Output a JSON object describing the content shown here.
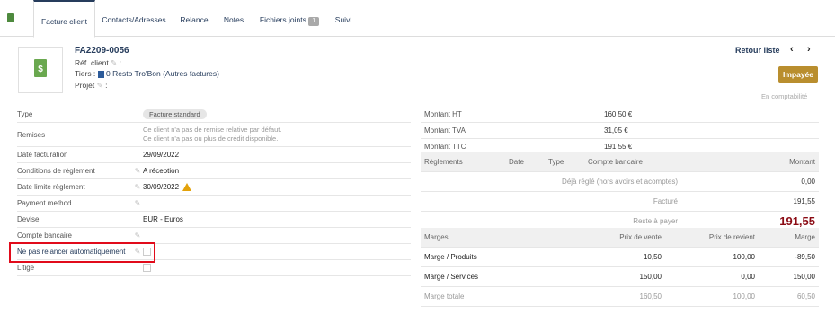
{
  "tabs": [
    {
      "label": "Facture client"
    },
    {
      "label": "Contacts/Adresses"
    },
    {
      "label": "Relance"
    },
    {
      "label": "Notes"
    },
    {
      "label": "Fichiers joints",
      "badge": "1"
    },
    {
      "label": "Suivi"
    }
  ],
  "header": {
    "ref": "FA2209-0056",
    "ref_client_label": "Réf. client",
    "tiers_label": "Tiers :",
    "tiers_value": "0 Resto Tro'Bon (Autres factures)",
    "projet_label": "Projet",
    "retour": "Retour liste",
    "status": "Impayée",
    "compta": "En comptabilité",
    "thumb_symbol": "$"
  },
  "fields": {
    "type_label": "Type",
    "type_value": "Facture standard",
    "remises_label": "Remises",
    "remises_hint1": "Ce client n'a pas de remise relative par défaut.",
    "remises_hint2": "Ce client n'a pas ou plus de crédit disponible.",
    "date_label": "Date facturation",
    "date_value": "29/09/2022",
    "cond_label": "Conditions de règlement",
    "cond_value": "A réception",
    "limite_label": "Date limite règlement",
    "limite_value": "30/09/2022",
    "payment_label": "Payment method",
    "devise_label": "Devise",
    "devise_value": "EUR - Euros",
    "compte_label": "Compte bancaire",
    "relance_label": "Ne pas relancer automatiquement",
    "litige_label": "Litige"
  },
  "amounts": {
    "ht_label": "Montant HT",
    "ht_value": "160,50 €",
    "tva_label": "Montant TVA",
    "tva_value": "31,05 €",
    "ttc_label": "Montant TTC",
    "ttc_value": "191,55 €"
  },
  "reglements": {
    "headers": [
      "Règlements",
      "Date",
      "Type",
      "Compte bancaire",
      "Montant"
    ],
    "deja_label": "Déjà réglé (hors avoirs et acomptes)",
    "deja_value": "0,00",
    "facture_label": "Facturé",
    "facture_value": "191,55",
    "reste_label": "Reste à payer",
    "reste_value": "191,55"
  },
  "marges": {
    "headers": [
      "Marges",
      "Prix de vente",
      "Prix de revient",
      "Marge"
    ],
    "rows": [
      {
        "label": "Marge / Produits",
        "vente": "10,50",
        "revient": "100,00",
        "marge": "-89,50"
      },
      {
        "label": "Marge / Services",
        "vente": "150,00",
        "revient": "0,00",
        "marge": "150,00"
      },
      {
        "label": "Marge totale",
        "vente": "160,50",
        "revient": "100,00",
        "marge": "60,50"
      }
    ]
  }
}
